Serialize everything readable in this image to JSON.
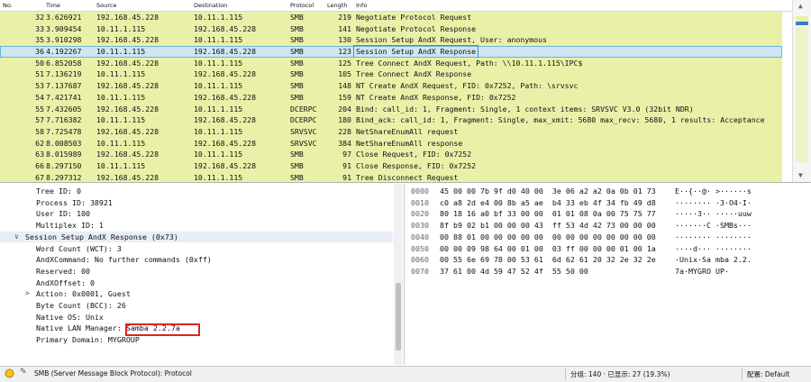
{
  "columns": [
    "No.",
    "Time",
    "Source",
    "Destination",
    "Protocol",
    "Length",
    "Info"
  ],
  "packets": [
    {
      "no": "32",
      "time": "3.626921",
      "src": "192.168.45.228",
      "dst": "10.11.1.115",
      "proto": "SMB",
      "len": "219",
      "info": "Negotiate Protocol Request"
    },
    {
      "no": "33",
      "time": "3.909454",
      "src": "10.11.1.115",
      "dst": "192.168.45.228",
      "proto": "SMB",
      "len": "141",
      "info": "Negotiate Protocol Response"
    },
    {
      "no": "35",
      "time": "3.910298",
      "src": "192.168.45.228",
      "dst": "10.11.1.115",
      "proto": "SMB",
      "len": "130",
      "info": "Session Setup AndX Request, User: anonymous"
    },
    {
      "no": "36",
      "time": "4.192267",
      "src": "10.11.1.115",
      "dst": "192.168.45.228",
      "proto": "SMB",
      "len": "123",
      "info": "Session Setup AndX Response"
    },
    {
      "no": "50",
      "time": "6.852058",
      "src": "192.168.45.228",
      "dst": "10.11.1.115",
      "proto": "SMB",
      "len": "125",
      "info": "Tree Connect AndX Request, Path: \\\\10.11.1.115\\IPC$"
    },
    {
      "no": "51",
      "time": "7.136219",
      "src": "10.11.1.115",
      "dst": "192.168.45.228",
      "proto": "SMB",
      "len": "105",
      "info": "Tree Connect AndX Response"
    },
    {
      "no": "53",
      "time": "7.137687",
      "src": "192.168.45.228",
      "dst": "10.11.1.115",
      "proto": "SMB",
      "len": "148",
      "info": "NT Create AndX Request, FID: 0x7252, Path: \\srvsvc"
    },
    {
      "no": "54",
      "time": "7.421741",
      "src": "10.11.1.115",
      "dst": "192.168.45.228",
      "proto": "SMB",
      "len": "159",
      "info": "NT Create AndX Response, FID: 0x7252"
    },
    {
      "no": "55",
      "time": "7.432605",
      "src": "192.168.45.228",
      "dst": "10.11.1.115",
      "proto": "DCERPC",
      "len": "204",
      "info": "Bind: call_id: 1, Fragment: Single, 1 context items: SRVSVC V3.0 (32bit NDR)"
    },
    {
      "no": "57",
      "time": "7.716382",
      "src": "10.11.1.115",
      "dst": "192.168.45.228",
      "proto": "DCERPC",
      "len": "180",
      "info": "Bind_ack: call_id: 1, Fragment: Single, max_xmit: 5680 max_recv: 5680, 1 results: Acceptance"
    },
    {
      "no": "58",
      "time": "7.725478",
      "src": "192.168.45.228",
      "dst": "10.11.1.115",
      "proto": "SRVSVC",
      "len": "228",
      "info": "NetShareEnumAll request"
    },
    {
      "no": "62",
      "time": "8.008503",
      "src": "10.11.1.115",
      "dst": "192.168.45.228",
      "proto": "SRVSVC",
      "len": "384",
      "info": "NetShareEnumAll response"
    },
    {
      "no": "63",
      "time": "8.015989",
      "src": "192.168.45.228",
      "dst": "10.11.1.115",
      "proto": "SMB",
      "len": "97",
      "info": "Close Request, FID: 0x7252"
    },
    {
      "no": "66",
      "time": "8.297150",
      "src": "10.11.1.115",
      "dst": "192.168.45.228",
      "proto": "SMB",
      "len": "91",
      "info": "Close Response, FID: 0x7252"
    },
    {
      "no": "67",
      "time": "8.297312",
      "src": "192.168.45.228",
      "dst": "10.11.1.115",
      "proto": "SMB",
      "len": "91",
      "info": "Tree Disconnect Request"
    }
  ],
  "details": [
    {
      "text": "Tree ID: 0",
      "indent": 40
    },
    {
      "text": "Process ID: 38921",
      "indent": 40
    },
    {
      "text": "User ID: 100",
      "indent": 40
    },
    {
      "text": "Multiplex ID: 1",
      "indent": 40
    },
    {
      "text": "Session Setup AndX Response (0x73)",
      "indent": 28,
      "toggle": "∨"
    },
    {
      "text": "Word Count (WCT): 3",
      "indent": 40
    },
    {
      "text": "AndXCommand: No further commands (0xff)",
      "indent": 40
    },
    {
      "text": "Reserved: 00",
      "indent": 40
    },
    {
      "text": "AndXOffset: 0",
      "indent": 40
    },
    {
      "text": "Action: 0x0001, Guest",
      "indent": 40,
      "toggle": ">"
    },
    {
      "text": "Byte Count (BCC): 26",
      "indent": 40
    },
    {
      "text": "Native OS: Unix",
      "indent": 40
    },
    {
      "text": "Native LAN Manager: Samba 2.2.7a",
      "indent": 40
    },
    {
      "text": "Primary Domain: MYGROUP",
      "indent": 40
    }
  ],
  "bytes": [
    {
      "off": "0000",
      "hex": "45 00 00 7b 9f d0 40 00  3e 06 a2 a2 0a 0b 01 73",
      "ascii": "E··{··@· >······s"
    },
    {
      "off": "0010",
      "hex": "c0 a8 2d e4 00 8b a5 ae  b4 33 eb 4f 34 fb 49 d8",
      "ascii": "··-····· ·3·O4·I·"
    },
    {
      "off": "0020",
      "hex": "80 18 16 a0 bf 33 00 00  01 01 08 0a 00 75 75 77",
      "ascii": "·····3·· ·····uuw"
    },
    {
      "off": "0030",
      "hex": "8f b9 02 b1 00 00 00 43  ff 53 4d 42 73 00 00 00",
      "ascii": "·······C ·SMBs···"
    },
    {
      "off": "0040",
      "hex": "00 88 01 00 00 00 00 00  00 00 00 00 00 00 00 00",
      "ascii": "········ ········"
    },
    {
      "off": "0050",
      "hex": "00 00 09 98 64 00 01 00  03 ff 00 00 00 01 00 1a",
      "ascii": "····d··· ········"
    },
    {
      "off": "0060",
      "hex": "00 55 6e 69 78 00 53 61  6d 62 61 20 32 2e 32 2e",
      "ascii": "·Unix·Sa mba 2.2."
    },
    {
      "off": "0070",
      "hex": "37 61 00 4d 59 47 52 4f  55 50 00",
      "ascii": "7a·MYGRO UP·"
    }
  ],
  "status": {
    "protocol": "SMB (Server Message Block Protocol): Protocol",
    "packets": "分组: 140 · 已显示: 27 (19.3%)",
    "profile": "配置: Default"
  },
  "colors": {
    "smb_row": "#e9f1a9",
    "selected_row": "#cfe6f5",
    "highlight_box": "#d9251d",
    "scroll_mark": "#3a7bc8"
  }
}
